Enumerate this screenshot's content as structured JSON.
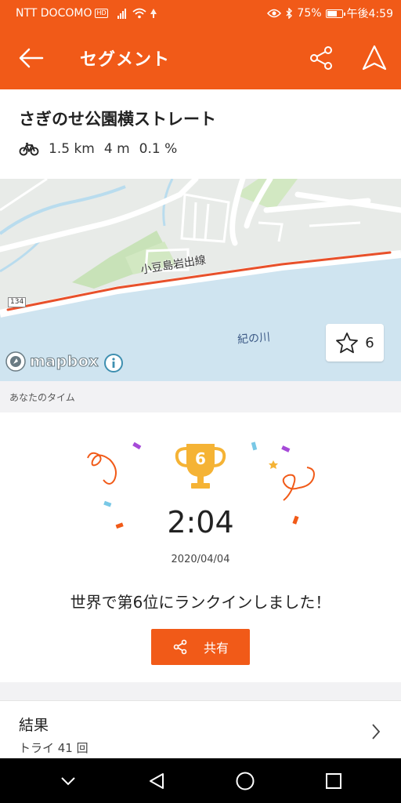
{
  "status_bar": {
    "carrier": "NTT DOCOMO",
    "hd_badge": "HD",
    "battery_percent": "75%",
    "battery_level": 0.75,
    "time": "午後4:59"
  },
  "app_bar": {
    "title": "セグメント",
    "back_icon": "arrow-left-icon",
    "share_icon": "share-icon",
    "navigate_icon": "navigation-arrow-icon"
  },
  "segment": {
    "name": "さぎのせ公園横ストレート",
    "activity_icon": "bicycle-icon",
    "distance": "1.5 km",
    "elevation": "4 m",
    "grade": "0.1 %"
  },
  "map": {
    "road_label": "小豆島岩出線",
    "river_label": "紀の川",
    "route_number": "134",
    "attribution": "mapbox",
    "star_count": "6",
    "route_color": "#e8502a"
  },
  "your_time_label": "あなたのタイム",
  "result": {
    "rank_badge": "6",
    "time": "2:04",
    "date": "2020/04/04",
    "rank_message": "世界で第6位にランクインしました！",
    "share_label": "共有"
  },
  "results_row": {
    "title": "結果",
    "attempts": "トライ 41 回"
  },
  "colors": {
    "brand": "#f15a18",
    "trophy": "#f5b335"
  }
}
